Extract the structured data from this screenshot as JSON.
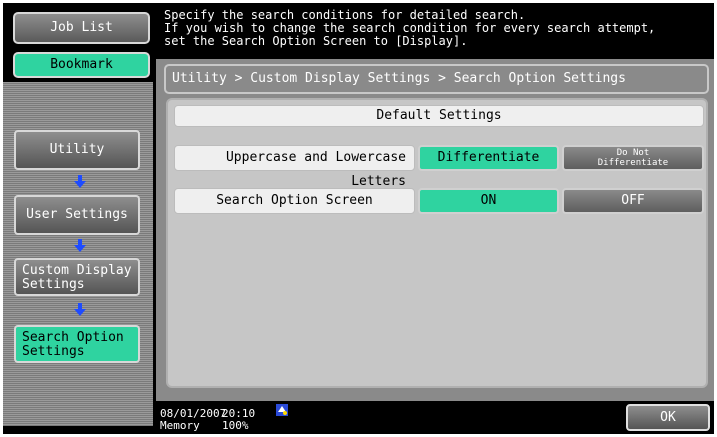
{
  "sidebar": {
    "job_list": "Job List",
    "bookmark": "Bookmark",
    "nav": [
      {
        "label": "Utility"
      },
      {
        "label": "User Settings"
      },
      {
        "label": "Custom Display Settings",
        "line1": "Custom Display",
        "line2": "Settings"
      },
      {
        "label": "Search Option Settings",
        "line1": "Search Option",
        "line2": "Settings"
      }
    ]
  },
  "message": {
    "line1": "Specify the search conditions for detailed search.",
    "line2": "If you wish to change the search condition for every search attempt,",
    "line3": "set the Search Option Screen to [Display]."
  },
  "breadcrumb": "Utility > Custom Display Settings > Search Option Settings",
  "main": {
    "default_settings": "Default Settings",
    "rows": [
      {
        "label": "Uppercase and Lowercase Letters",
        "option_a": "Differentiate",
        "option_b_line1": "Do Not",
        "option_b_line2": "Differentiate",
        "selected": "option_a"
      },
      {
        "label": "Search Option Screen",
        "option_a": "ON",
        "option_b": "OFF",
        "selected": "option_a"
      }
    ]
  },
  "footer": {
    "date": "08/01/2007",
    "time": "20:10",
    "memory_label": "Memory",
    "memory_value": "100%",
    "ok_label": "OK"
  },
  "colors": {
    "accent_green": "#2fd3a0",
    "panel_grey": "#8a8a8a",
    "content_grey": "#c6c6c6"
  }
}
